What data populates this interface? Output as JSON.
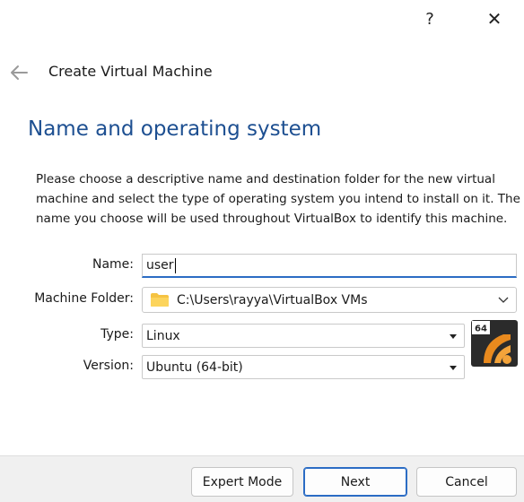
{
  "titlebar": {
    "help_glyph": "?",
    "close_glyph": "✕"
  },
  "wizard": {
    "title": "Create Virtual Machine",
    "back_icon": "back-arrow-icon"
  },
  "page": {
    "title": "Name and operating system",
    "description": "Please choose a descriptive name and destination folder for the new virtual machine and select the type of operating system you intend to install on it. The name you choose will be used throughout VirtualBox to identify this machine."
  },
  "form": {
    "name": {
      "label": "Name:",
      "value": "user"
    },
    "folder": {
      "label": "Machine Folder:",
      "value": "C:\\Users\\rayya\\VirtualBox VMs"
    },
    "type": {
      "label": "Type:",
      "value": "Linux"
    },
    "version": {
      "label": "Version:",
      "value": "Ubuntu (64-bit)"
    },
    "os_badge": "64"
  },
  "buttons": {
    "expert": "Expert Mode",
    "next": "Next",
    "cancel": "Cancel"
  },
  "colors": {
    "accent": "#2b6cc4",
    "title_blue": "#1d4f91",
    "footer_bg": "#f0f0f0"
  }
}
